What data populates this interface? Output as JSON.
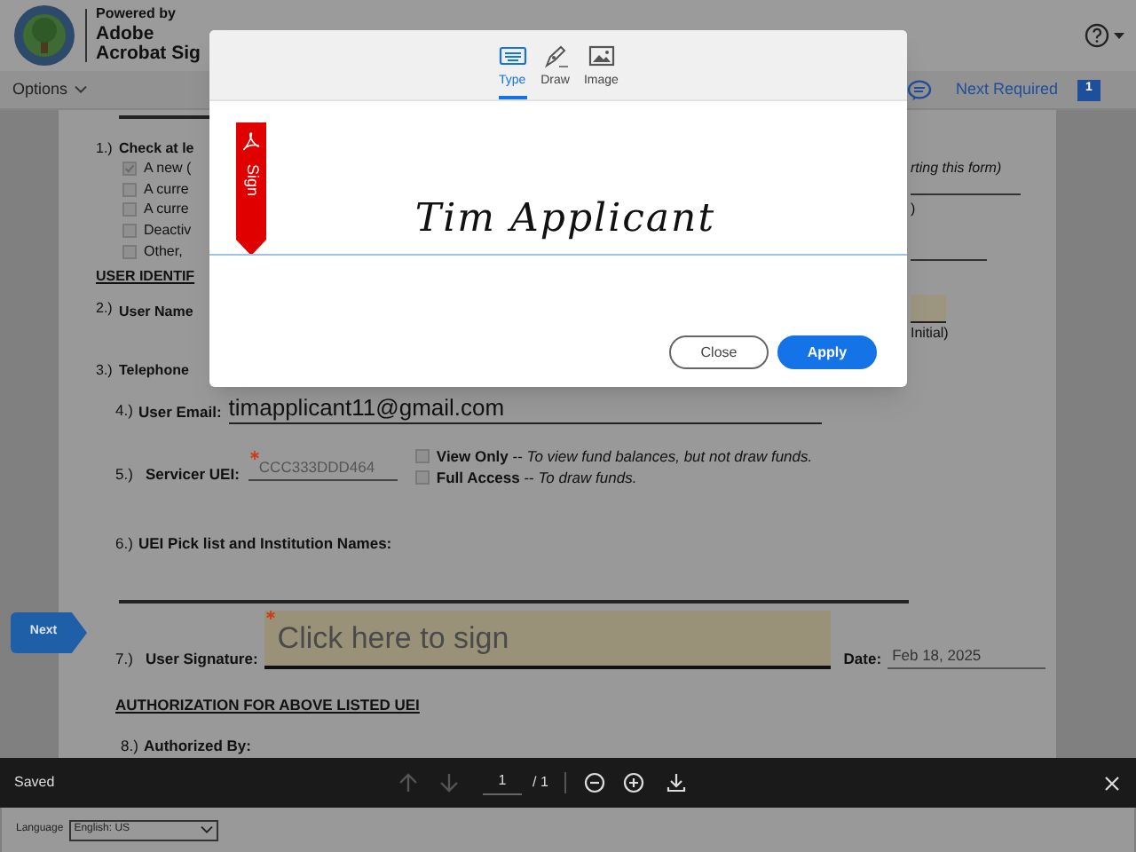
{
  "header": {
    "powered_by": "Powered by",
    "brand_line_1": "Adobe",
    "brand_line_2": "Acrobat Sig"
  },
  "toolbar": {
    "options": "Options",
    "next_required": "Next Required",
    "required_count": "1"
  },
  "dialog": {
    "tabs": [
      {
        "label": "Type",
        "selected": true
      },
      {
        "label": "Draw",
        "selected": false
      },
      {
        "label": "Image",
        "selected": false
      }
    ],
    "flag_label": "Sign",
    "signature": "Tim Applicant",
    "buttons": [
      {
        "label": "Close",
        "kind": "secondary"
      },
      {
        "label": "Apply",
        "kind": "primary"
      }
    ]
  },
  "form": {
    "q1": {
      "number": "1.)",
      "label": "Check at le",
      "options": [
        {
          "label": "A new (",
          "checked": true
        },
        {
          "label": "A curre",
          "checked": false
        },
        {
          "label": "A curre",
          "checked": false
        },
        {
          "label": "Deactiv",
          "checked": false
        },
        {
          "label": "Other,",
          "checked": false
        }
      ],
      "note": "rting this form)",
      "paren": ")"
    },
    "user_id_heading": "USER IDENTIF",
    "q2": {
      "number": "2.)",
      "label": "User Name",
      "hint": "Initial)"
    },
    "q3": {
      "number": "3.)",
      "label": "Telephone"
    },
    "q4": {
      "number": "4.)",
      "label": "User Email:",
      "value": "timapplicant11@gmail.com"
    },
    "q5": {
      "number": "5.)",
      "label": "Servicer UEI:",
      "value": "CCC333DDD464",
      "required": true,
      "access": [
        {
          "text": "**View Only** -- *To view fund balances, but not draw funds.*",
          "checked": false
        },
        {
          "text": "**Full Access** -- *To draw funds.*",
          "checked": false
        }
      ]
    },
    "q6": {
      "number": "6.)",
      "label": "UEI Pick list and Institution Names:"
    },
    "q7": {
      "number": "7.)",
      "label": "User Signature:",
      "sign_prompt": "Click here to sign",
      "required": true,
      "date_label": "Date:",
      "date": "Feb 18, 2025"
    },
    "auth_heading": "AUTHORIZATION FOR ABOVE LISTED UEI",
    "q8": {
      "number": "8.)",
      "label": "Authorized By:"
    }
  },
  "next_tag": "Next",
  "bottom_bar": {
    "status": "Saved",
    "page": "1",
    "page_total": "/ 1"
  },
  "footer": {
    "language_label": "Language",
    "language_value": "English: US"
  }
}
